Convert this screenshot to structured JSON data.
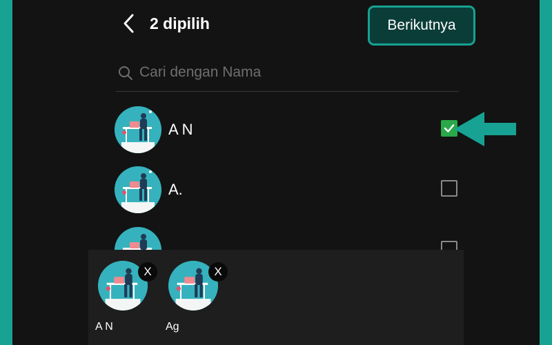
{
  "header": {
    "back_icon": "chevron-left-icon",
    "title": "2 dipilih",
    "next_label": "Berikutnya"
  },
  "search": {
    "icon": "search-icon",
    "placeholder": "Cari dengan Nama",
    "value": ""
  },
  "contacts": [
    {
      "name": "A N",
      "checked": true
    },
    {
      "name": "A.",
      "checked": false
    },
    {
      "name": "",
      "checked": false
    }
  ],
  "selected": [
    {
      "name": "A N",
      "remove_label": "X"
    },
    {
      "name": "Ag",
      "remove_label": "X"
    }
  ],
  "colors": {
    "accent": "#17a293",
    "background": "#131313",
    "checkbox_checked": "#2aa84a",
    "tray": "#1e1e1e"
  }
}
